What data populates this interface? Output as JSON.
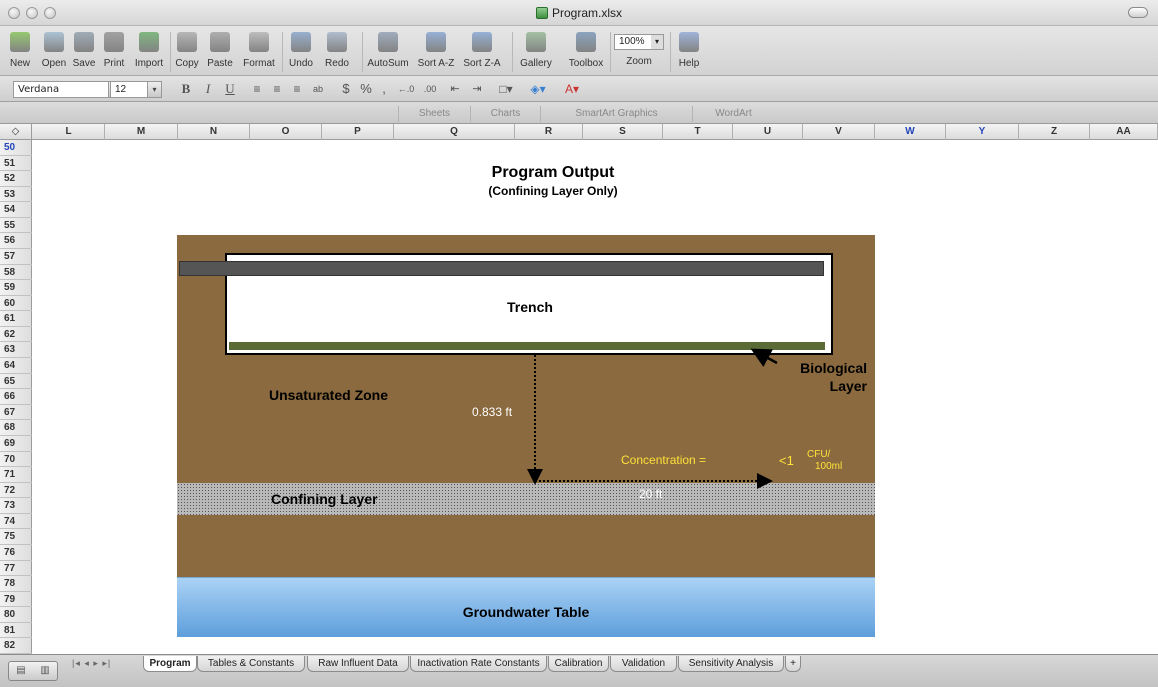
{
  "window": {
    "title": "Program.xlsx"
  },
  "toolbar": {
    "buttons": [
      {
        "label": "New",
        "icon": "new-icon",
        "color": "#7cbf4a"
      },
      {
        "label": "Open",
        "icon": "open-icon",
        "color": "#9ab7cf"
      },
      {
        "label": "Save",
        "icon": "save-icon",
        "color": "#8a9aa8"
      },
      {
        "label": "Print",
        "icon": "print-icon",
        "color": "#8c8c8c"
      },
      {
        "label": "Import",
        "icon": "import-icon",
        "color": "#5fa85f"
      },
      {
        "label": "Copy",
        "icon": "copy-icon",
        "color": "#a8a8a8"
      },
      {
        "label": "Paste",
        "icon": "paste-icon",
        "color": "#9c9c9c"
      },
      {
        "label": "Format",
        "icon": "format-brush-icon",
        "color": "#b0b0b0"
      },
      {
        "label": "Undo",
        "icon": "undo-icon",
        "color": "#7f9fc8"
      },
      {
        "label": "Redo",
        "icon": "redo-icon",
        "color": "#9fb0c8"
      },
      {
        "label": "AutoSum",
        "icon": "autosum-icon",
        "color": "#8a9ab0"
      },
      {
        "label": "Sort A-Z",
        "icon": "sort-az-icon",
        "color": "#7d9fd0"
      },
      {
        "label": "Sort Z-A",
        "icon": "sort-za-icon",
        "color": "#7d9fd0"
      },
      {
        "label": "Gallery",
        "icon": "gallery-icon",
        "color": "#8fb58f"
      },
      {
        "label": "Toolbox",
        "icon": "toolbox-icon",
        "color": "#6f8fb3"
      },
      {
        "label": "Zoom",
        "icon": "zoom-icon",
        "color": "#ffffff"
      },
      {
        "label": "Help",
        "icon": "help-icon",
        "color": "#8aa3d6"
      }
    ],
    "zoom_value": "100%"
  },
  "format_bar": {
    "font": "Verdana",
    "size": "12",
    "bold": "B",
    "italic": "I",
    "underline": "U",
    "currency": "$",
    "percent": "%",
    "comma": ","
  },
  "elements_gallery": [
    "Sheets",
    "Charts",
    "SmartArt Graphics",
    "WordArt"
  ],
  "columns": [
    "L",
    "M",
    "N",
    "O",
    "P",
    "Q",
    "R",
    "S",
    "T",
    "U",
    "V",
    "W",
    "Y",
    "Z",
    "AA"
  ],
  "rows": [
    "50",
    "51",
    "52",
    "53",
    "54",
    "55",
    "56",
    "57",
    "58",
    "59",
    "60",
    "61",
    "62",
    "63",
    "64",
    "65",
    "66",
    "67",
    "68",
    "69",
    "70",
    "71",
    "72",
    "73",
    "74",
    "75",
    "76",
    "77",
    "78",
    "79",
    "80",
    "81",
    "82"
  ],
  "sheet": {
    "title": "Program Output",
    "subtitle": "(Confining Layer Only)",
    "diagram": {
      "trench": "Trench",
      "biological_layer": [
        "Biological",
        "Layer"
      ],
      "unsaturated_zone": "Unsaturated Zone",
      "depth": "0.833  ft",
      "concentration_label": "Concentration =",
      "concentration_value": "<1",
      "concentration_unit": [
        "CFU/",
        "100ml"
      ],
      "confining_layer": "Confining Layer",
      "distance": "20  ft",
      "groundwater": "Groundwater Table",
      "colors": {
        "soil": "#8a6a3e",
        "pipe": "#555555",
        "biolayer": "#5a6b35",
        "concentration_text": "#ffe23a",
        "groundwater": "#6fa8df"
      }
    }
  },
  "sheet_tabs": [
    "Program",
    "Tables & Constants",
    "Raw  Influent Data",
    "Inactivation Rate Constants",
    "Calibration",
    "Validation",
    "Sensitivity Analysis",
    "+"
  ]
}
